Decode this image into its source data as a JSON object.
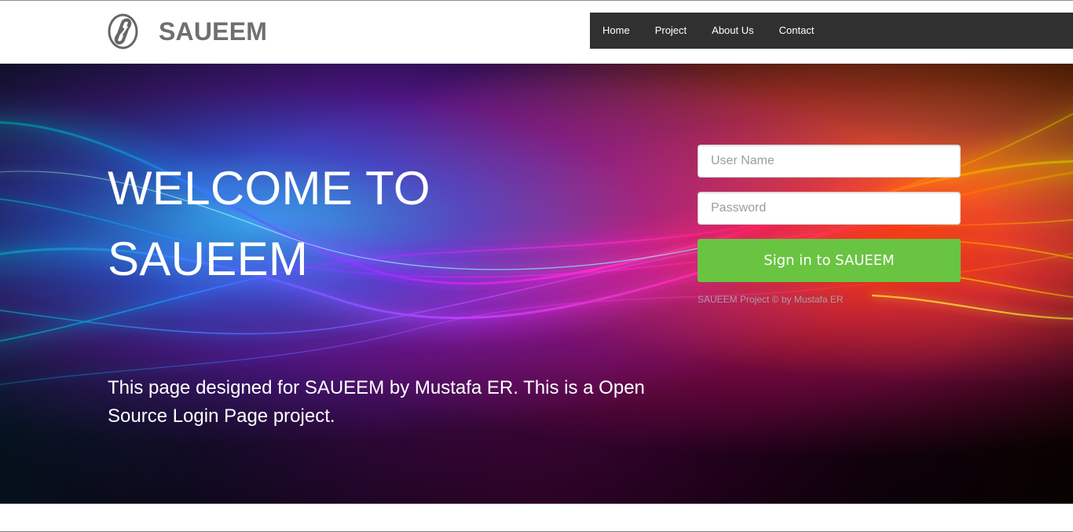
{
  "header": {
    "brand_name": "SAUEEM",
    "logo_icon": "saueem-logo-icon"
  },
  "nav": {
    "items": [
      {
        "label": "Home"
      },
      {
        "label": "Project"
      },
      {
        "label": "About Us"
      },
      {
        "label": "Contact"
      }
    ]
  },
  "hero": {
    "title_line_1": "WELCOME TO",
    "title_line_2": "SAUEEM",
    "description": "This page designed for SAUEEM by Mustafa ER. This is a Open Source Login Page project."
  },
  "login": {
    "username_placeholder": "User Name",
    "username_value": "",
    "password_placeholder": "Password",
    "password_value": "",
    "button_label": "Sign in to SAUEEM",
    "footer_text": "SAUEEM Project © by Mustafa ER"
  },
  "colors": {
    "nav_background": "#303030",
    "brand_text": "#6f6f6f",
    "button_green": "#69c442",
    "footer_text": "#a79faa"
  }
}
